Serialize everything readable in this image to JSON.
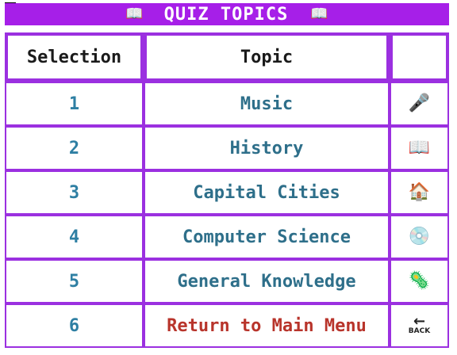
{
  "header": {
    "title": "QUIZ TOPICS",
    "left_icon": "📖",
    "right_icon": "📖"
  },
  "table": {
    "columns": [
      "Selection",
      "Topic",
      ""
    ],
    "rows": [
      {
        "selection": "1",
        "topic": "Music",
        "icon": "🎤",
        "icon_name": "microphone-icon",
        "color": "#2e6f8a"
      },
      {
        "selection": "2",
        "topic": "History",
        "icon": "📖",
        "icon_name": "book-icon",
        "color": "#2e6f8a"
      },
      {
        "selection": "3",
        "topic": "Capital Cities",
        "icon": "🏠",
        "icon_name": "house-icon",
        "color": "#2e6f8a"
      },
      {
        "selection": "4",
        "topic": "Computer Science",
        "icon": "💿",
        "icon_name": "disc-icon",
        "color": "#2e6f8a"
      },
      {
        "selection": "5",
        "topic": "General Knowledge",
        "icon": "🦠",
        "icon_name": "microbe-icon",
        "color": "#2e6f8a"
      },
      {
        "selection": "6",
        "topic": "Return to Main Menu",
        "icon": "🔙",
        "icon_name": "back-arrow-icon",
        "icon_label": "BACK",
        "color": "#b8342b"
      }
    ]
  },
  "colors": {
    "accent": "#a61fe8",
    "border": "#9b30e0",
    "topic_text": "#2e6f8a",
    "number_text": "#2e7fa3",
    "return_text": "#b8342b"
  }
}
